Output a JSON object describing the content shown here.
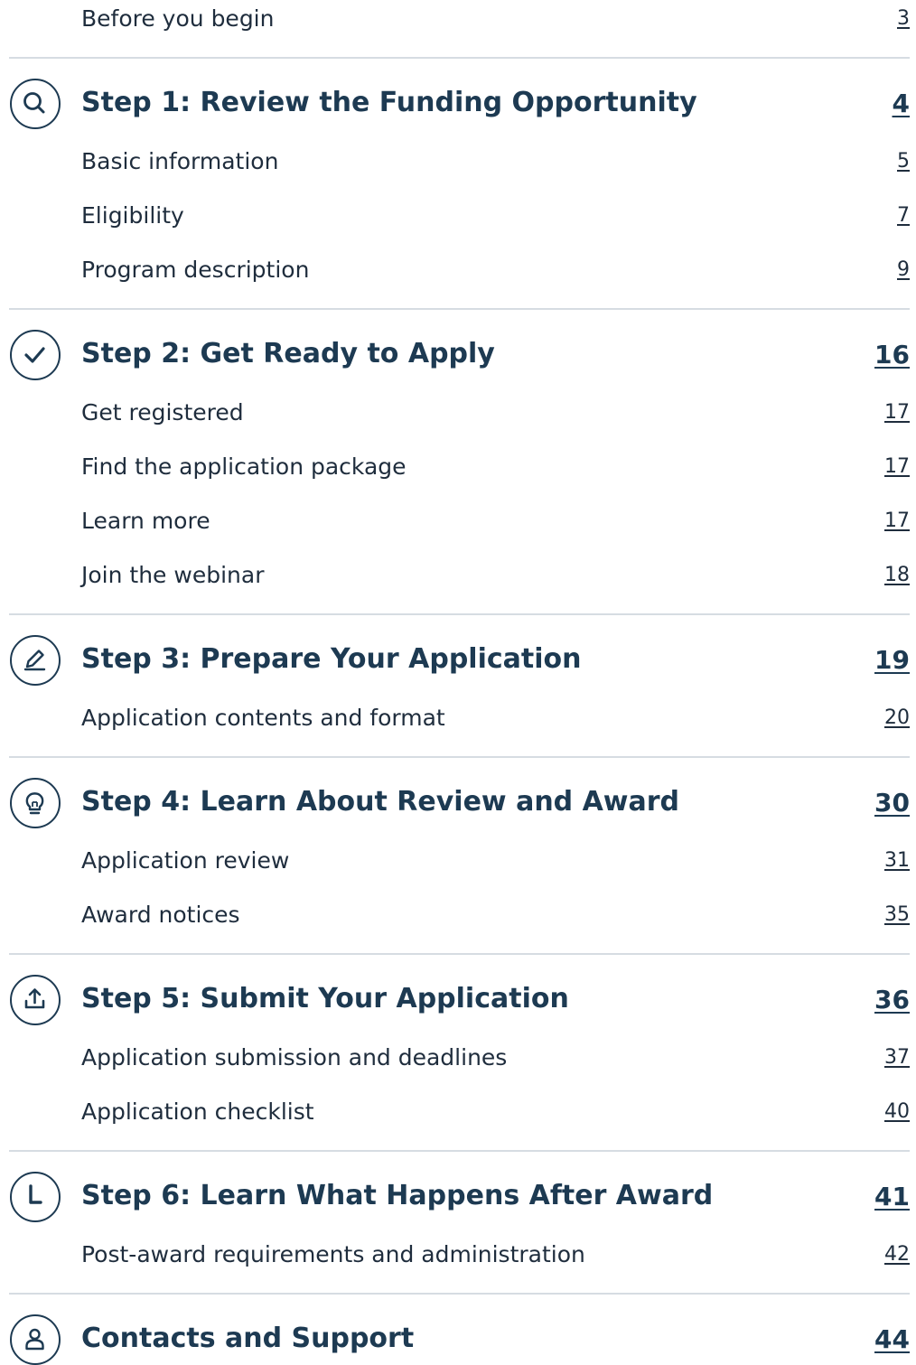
{
  "toc": {
    "before": {
      "title": "Before you begin",
      "page": "3"
    },
    "steps": [
      {
        "title": "Step 1: Review the Funding Opportunity",
        "page": "4",
        "icon": "search-icon",
        "items": [
          {
            "title": "Basic information",
            "page": "5"
          },
          {
            "title": "Eligibility",
            "page": "7"
          },
          {
            "title": "Program description",
            "page": "9"
          }
        ]
      },
      {
        "title": "Step 2: Get Ready to Apply",
        "page": "16",
        "icon": "check-circle-icon",
        "items": [
          {
            "title": "Get registered",
            "page": "17"
          },
          {
            "title": "Find the application package",
            "page": "17"
          },
          {
            "title": "Learn more",
            "page": "17"
          },
          {
            "title": "Join the webinar",
            "page": "18"
          }
        ]
      },
      {
        "title": "Step 3: Prepare Your Application",
        "page": "19",
        "icon": "pencil-icon",
        "items": [
          {
            "title": "Application contents and format",
            "page": "20"
          }
        ]
      },
      {
        "title": "Step 4: Learn About Review and Award",
        "page": "30",
        "icon": "lightbulb-icon",
        "items": [
          {
            "title": "Application review",
            "page": "31"
          },
          {
            "title": "Award notices",
            "page": "35"
          }
        ]
      },
      {
        "title": "Step 5: Submit Your Application",
        "page": "36",
        "icon": "upload-icon",
        "items": [
          {
            "title": "Application submission and deadlines",
            "page": "37"
          },
          {
            "title": "Application checklist",
            "page": "40"
          }
        ]
      },
      {
        "title": "Step 6: Learn What Happens After Award",
        "page": "41",
        "icon": "clock-icon",
        "items": [
          {
            "title": "Post-award requirements and administration",
            "page": "42"
          }
        ]
      },
      {
        "title": "Contacts and Support",
        "page": "44",
        "icon": "person-icon",
        "items": []
      }
    ]
  }
}
